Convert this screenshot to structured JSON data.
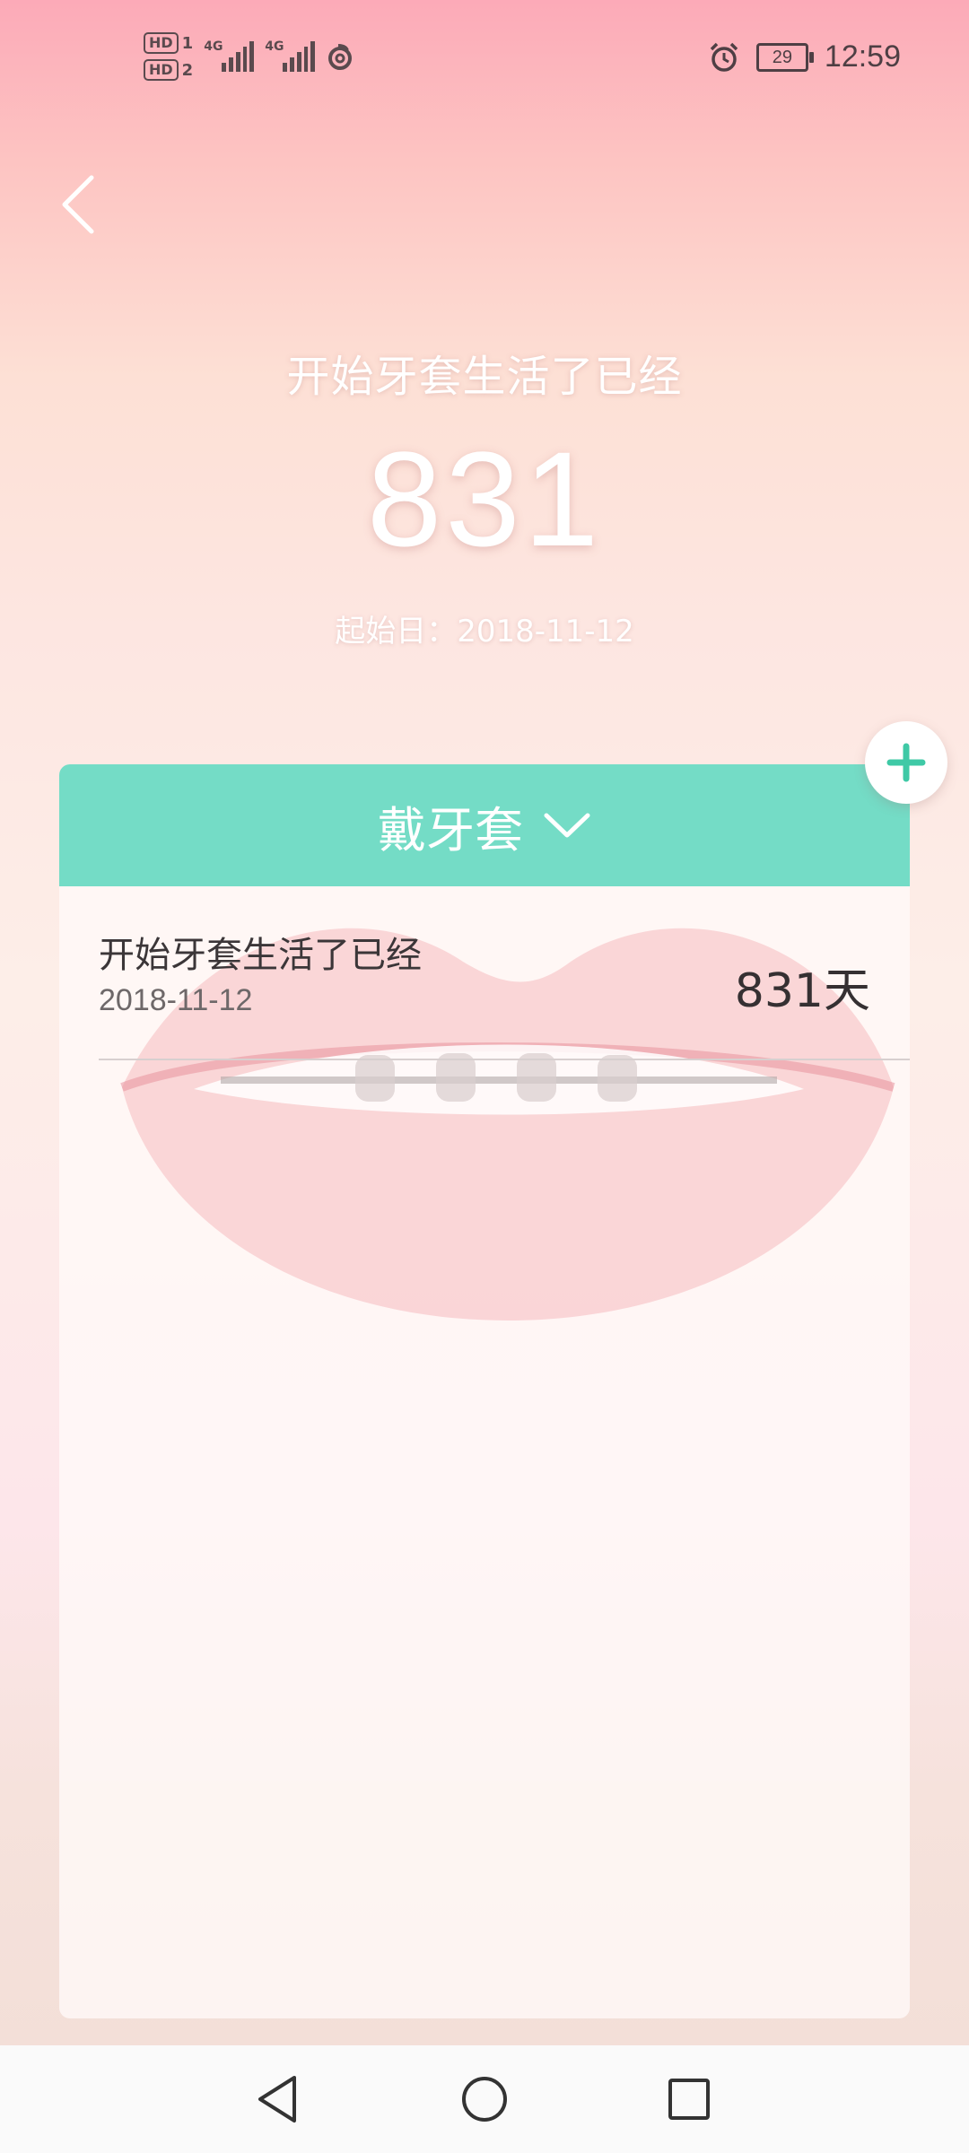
{
  "status_bar": {
    "hd1": "HD",
    "hd1_sub": "1",
    "hd2": "HD",
    "hd2_sub": "2",
    "net1": "4G",
    "net2": "4G",
    "battery": "29",
    "time": "12:59",
    "icons": [
      "hd-icon",
      "signal-icon",
      "signal-icon",
      "netease-music-icon",
      "alarm-icon",
      "battery-icon"
    ]
  },
  "hero": {
    "title": "开始牙套生活了已经",
    "days": "831",
    "start_label": "起始日：2018-11-12"
  },
  "card": {
    "header_label": "戴牙套",
    "entries": [
      {
        "title": "开始牙套生活了已经",
        "date": "2018-11-12",
        "days": "831天"
      }
    ]
  },
  "colors": {
    "accent": "#74dcc6",
    "plus": "#3fc9a6",
    "text_dark": "#3b3638"
  }
}
